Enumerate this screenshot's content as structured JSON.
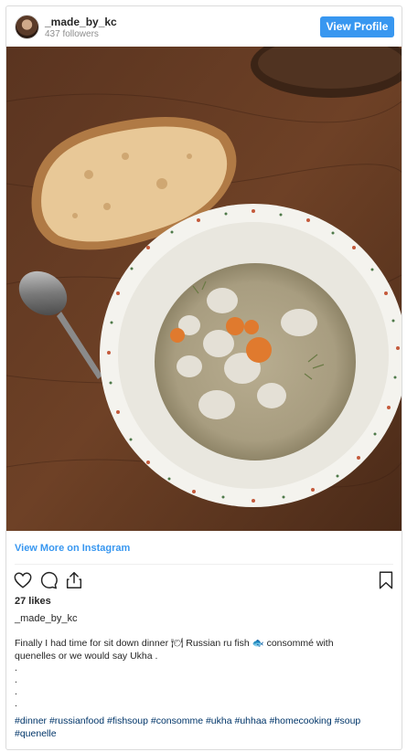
{
  "header": {
    "username": "_made_by_kc",
    "followers": "437 followers",
    "view_profile_label": "View Profile"
  },
  "post": {
    "view_more_label": "View More on Instagram",
    "likes": "27 likes",
    "owner": "_made_by_kc",
    "caption_line1": "Finally I had time for sit down dinner 🍽 Russian ru fish 🐟 consommé with",
    "caption_line2": "quenelles or we would say Ukha .",
    "dots": [
      ".",
      ".",
      ".",
      "."
    ],
    "hashtags": "#dinner #russianfood #fishsoup #consomme #ukha #uhhaa #homecooking #soup #quenelle"
  },
  "icons": {
    "like": "heart-icon",
    "comment": "comment-icon",
    "share": "share-icon",
    "save": "bookmark-icon"
  },
  "colors": {
    "accent": "#3897f0",
    "hashtag": "#003569",
    "border": "#dbdbdb"
  }
}
